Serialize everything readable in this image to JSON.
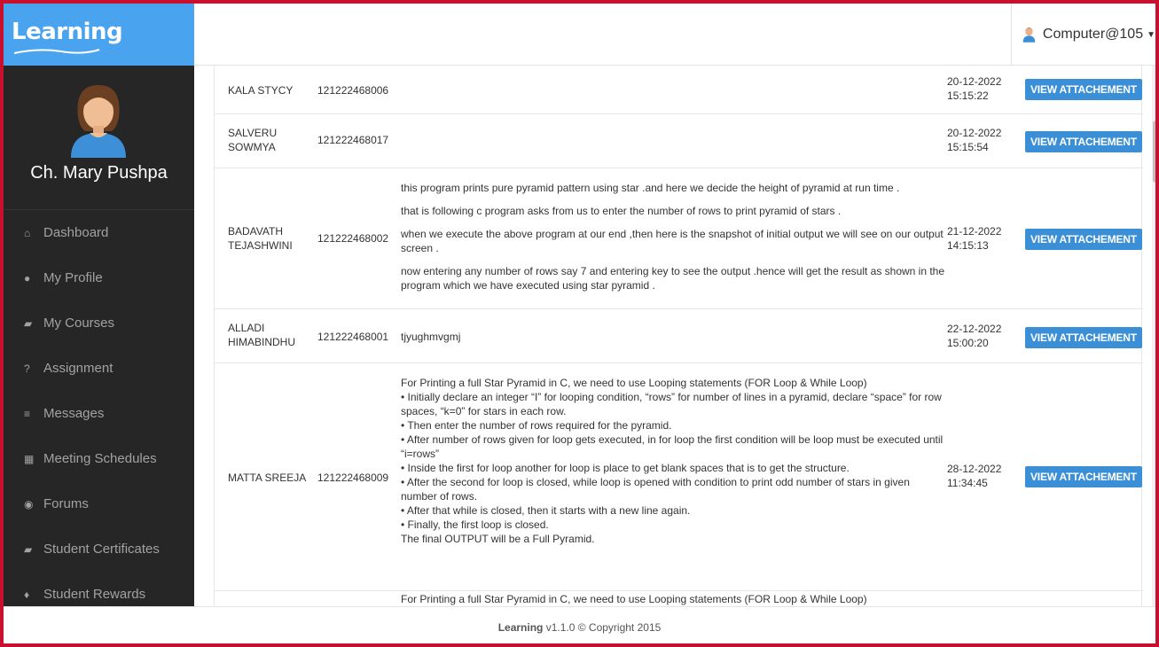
{
  "brand": {
    "name": "Learning"
  },
  "user": {
    "name": "Computer@105",
    "icon": "user-avatar-icon"
  },
  "sidebar": {
    "profile_name": "Ch. Mary Pushpa",
    "items": [
      {
        "label": "Dashboard",
        "icon": "home-icon",
        "glyph": "⌂"
      },
      {
        "label": "My Profile",
        "icon": "user-icon",
        "glyph": "●"
      },
      {
        "label": "My Courses",
        "icon": "book-icon",
        "glyph": "▰"
      },
      {
        "label": "Assignment",
        "icon": "question-icon",
        "glyph": "?"
      },
      {
        "label": "Messages",
        "icon": "list-icon",
        "glyph": "≡"
      },
      {
        "label": "Meeting Schedules",
        "icon": "calendar-icon",
        "glyph": "▦"
      },
      {
        "label": "Forums",
        "icon": "comments-icon",
        "glyph": "◉"
      },
      {
        "label": "Student Certificates",
        "icon": "book-icon",
        "glyph": "▰"
      },
      {
        "label": "Student Rewards",
        "icon": "trophy-icon",
        "glyph": "♦"
      }
    ]
  },
  "table": {
    "button_label": "VIEW ATTACHEMENT",
    "rows": [
      {
        "name": "KALA STYCY",
        "roll": "121222468006",
        "date": "20-12-2022",
        "time": "15:15:22"
      },
      {
        "name": "SALVERU SOWMYA",
        "roll": "121222468017",
        "date": "20-12-2022",
        "time": "15:15:54"
      },
      {
        "name": "BADAVATH TEJASHWINI",
        "roll": "121222468002",
        "date": "21-12-2022",
        "time": "14:15:13",
        "paragraphs": [
          "this program prints pure pyramid pattern using star .and here we decide the height of pyramid at run time .",
          "that is following c program asks from us to enter the number of rows to print pyramid of stars .",
          "when we execute the above program at our end ,then here is the snapshot of initial output we will see on our output screen .",
          "now entering any number of rows say 7 and entering key to see the output .hence will get the result as shown in the program which we have executed using star pyramid ."
        ]
      },
      {
        "name": "ALLADI HIMABINDHU",
        "roll": "121222468001",
        "date": "22-12-2022",
        "time": "15:00:20",
        "message": "tjyughmvgmj"
      },
      {
        "name": "MATTA SREEJA",
        "roll": "121222468009",
        "date": "28-12-2022",
        "time": "11:34:45",
        "lines": [
          "For Printing a full Star Pyramid in C, we need to use Looping statements (FOR Loop & While Loop)",
          "•     Initially declare an integer “I” for looping condition, “rows” for number of lines in a pyramid, declare “space” for row spaces, “k=0” for stars in each row.",
          "•     Then enter the number of rows required for the pyramid.",
          "•     After number of rows given for loop gets executed, in for loop the first condition will be loop must be executed until “i=rows”",
          "•     Inside the first for loop another for loop is place to get blank spaces that is to get the structure.",
          "•     After the second for loop is closed, while loop is opened with condition to print odd number of stars in given number of rows.",
          "•     After that while is closed, then it starts with a new line again.",
          "•     Finally, the first loop is closed.",
          "The final OUTPUT will be a Full Pyramid."
        ]
      }
    ],
    "cut_row_text": "For Printing a full Star Pyramid in C, we need to use Looping statements (FOR Loop & While Loop)"
  },
  "footer": {
    "brand": "Learning",
    "text": " v1.1.0 © Copyright 2015"
  },
  "colors": {
    "brand_blue": "#4aa3ef",
    "sidebar_bg": "#262626",
    "button_blue": "#3b8fd6",
    "frame_red": "#c8102e"
  }
}
